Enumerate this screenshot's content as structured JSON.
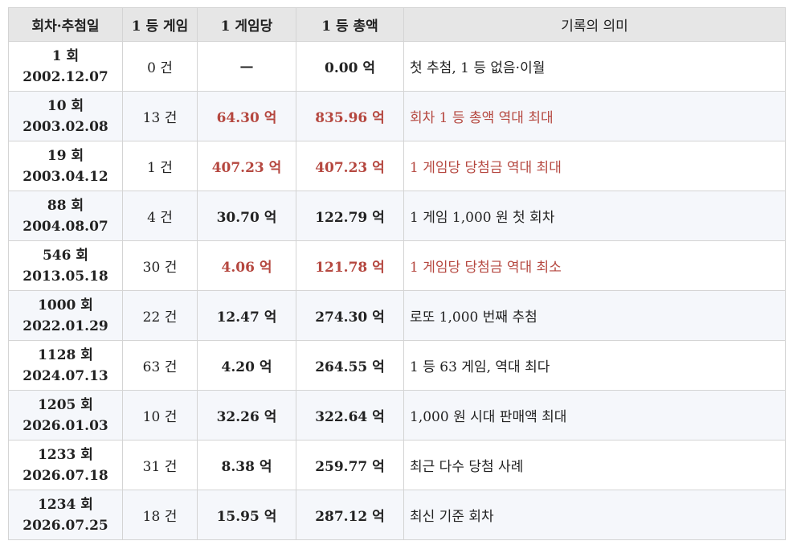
{
  "table": {
    "headers": [
      "회차·추첨일",
      "1 등 게임",
      "1 게임당",
      "1 등 총액",
      "기록의 의미"
    ],
    "rows": [
      {
        "draw": "1 회",
        "date": "2002.12.07",
        "games": "0 건",
        "per_game": "—",
        "total": "0.00 억",
        "note": "첫 추첨, 1 등 없음·이월",
        "highlight": false
      },
      {
        "draw": "10 회",
        "date": "2003.02.08",
        "games": "13 건",
        "per_game": "64.30 억",
        "total": "835.96 억",
        "note": "회차 1 등 총액 역대 최대",
        "highlight": true
      },
      {
        "draw": "19 회",
        "date": "2003.04.12",
        "games": "1 건",
        "per_game": "407.23 억",
        "total": "407.23 억",
        "note": "1 게임당 당첨금 역대 최대",
        "highlight": true
      },
      {
        "draw": "88 회",
        "date": "2004.08.07",
        "games": "4 건",
        "per_game": "30.70 억",
        "total": "122.79 억",
        "note": "1 게임 1,000 원 첫 회차",
        "highlight": false
      },
      {
        "draw": "546 회",
        "date": "2013.05.18",
        "games": "30 건",
        "per_game": "4.06 억",
        "total": "121.78 억",
        "note": "1 게임당 당첨금 역대 최소",
        "highlight": true
      },
      {
        "draw": "1000 회",
        "date": "2022.01.29",
        "games": "22 건",
        "per_game": "12.47 억",
        "total": "274.30 억",
        "note": "로또 1,000 번째 추첨",
        "highlight": false
      },
      {
        "draw": "1128 회",
        "date": "2024.07.13",
        "games": "63 건",
        "per_game": "4.20 억",
        "total": "264.55 억",
        "note": "1 등 63 게임, 역대 최다",
        "highlight": false
      },
      {
        "draw": "1205 회",
        "date": "2026.01.03",
        "games": "10 건",
        "per_game": "32.26 억",
        "total": "322.64 억",
        "note": "1,000 원 시대 판매액 최대",
        "highlight": false
      },
      {
        "draw": "1233 회",
        "date": "2026.07.18",
        "games": "31 건",
        "per_game": "8.38 억",
        "total": "259.77 억",
        "note": "최근 다수 당첨 사례",
        "highlight": false
      },
      {
        "draw": "1234 회",
        "date": "2026.07.25",
        "games": "18 건",
        "per_game": "15.95 억",
        "total": "287.12 억",
        "note": "최신 기준 회차",
        "highlight": false
      }
    ]
  },
  "colors": {
    "highlight": "#b5473f",
    "header_bg": "#e6e6e6",
    "stripe_bg": "#f5f7fb",
    "border": "#d4d4d4"
  }
}
